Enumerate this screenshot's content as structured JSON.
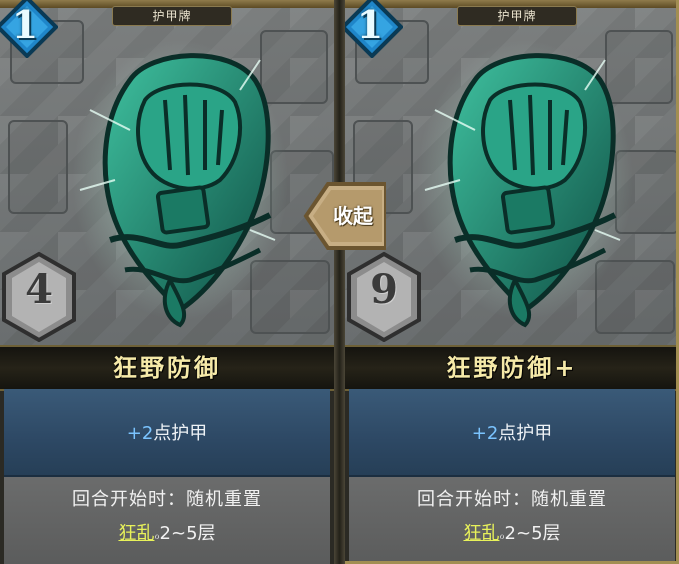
{
  "cards": [
    {
      "type_label": "护甲牌",
      "cost": "1",
      "value": "4",
      "name": "狂野防御",
      "effect_prefix": "+",
      "effect_number": "2",
      "effect_suffix": "点护甲",
      "desc_line1": "回合开始时：随机重置",
      "keyword": "狂乱",
      "keyword_rest": "2~5层"
    },
    {
      "type_label": "护甲牌",
      "cost": "1",
      "value": "9",
      "name": "狂野防御+",
      "effect_prefix": "+",
      "effect_number": "2",
      "effect_suffix": "点护甲",
      "desc_line1": "回合开始时：随机重置",
      "keyword": "狂乱",
      "keyword_rest": "2~5层"
    }
  ],
  "collapse_button": {
    "label": "收起"
  },
  "colors": {
    "cost_gem": "#1f86c9",
    "armor_green": "#1f8a72",
    "name_gold": "#f5e9a8",
    "effect_number": "#7bc4ff",
    "keyword": "#e8f25a"
  },
  "icons": {
    "card_art": "green-armor-pauldron",
    "cost": "blue-diamond-gem",
    "value": "grey-stone-hexagon"
  }
}
